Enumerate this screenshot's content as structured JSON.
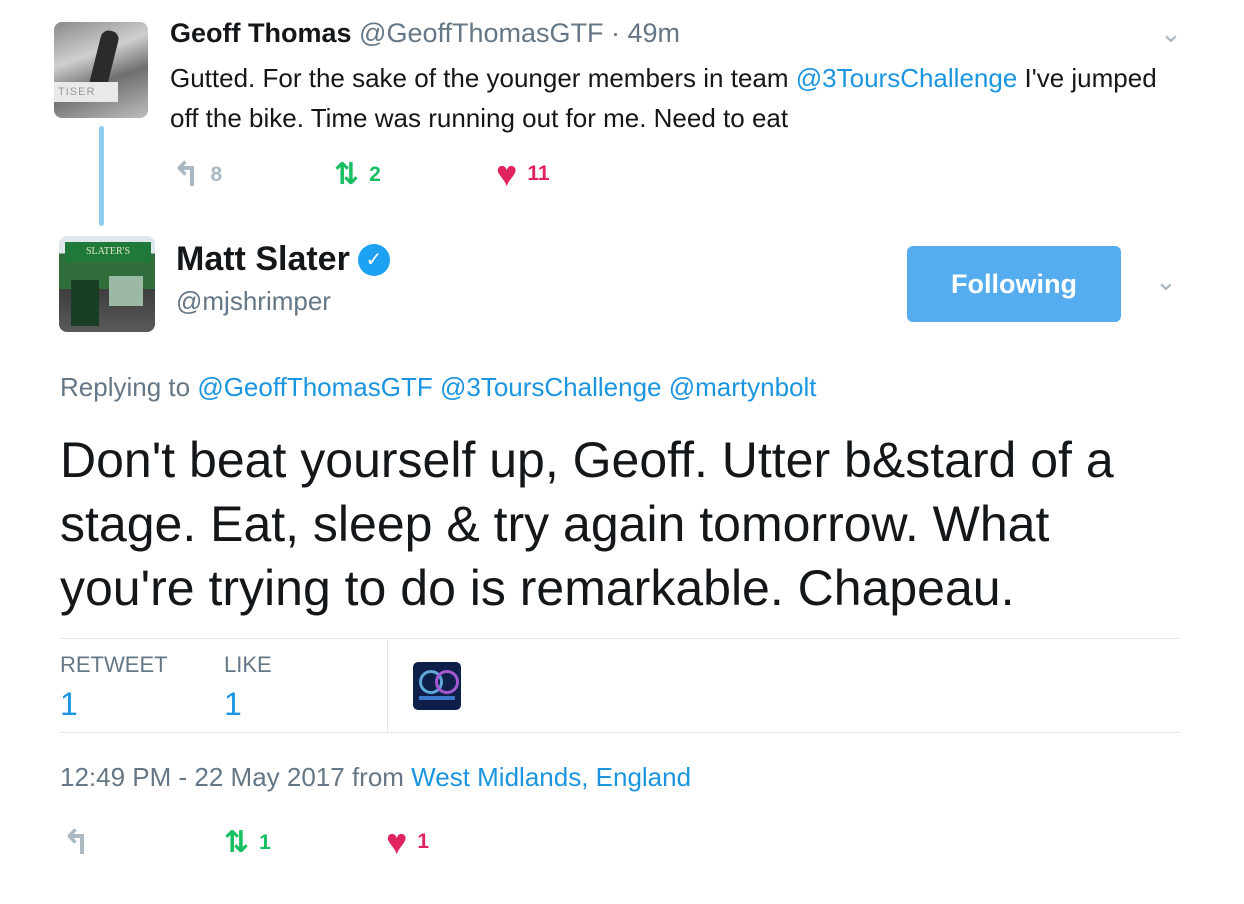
{
  "parent": {
    "name": "Geoff Thomas",
    "handle": "@GeoffThomasGTF",
    "dot": " · ",
    "time": "49m",
    "text_before": "Gutted. For the sake of the younger members in team ",
    "mention": "@3ToursChallenge",
    "text_after": " I've jumped off the bike. Time was running out for me. Need to eat",
    "avatar_sign": "TISER",
    "replies": "8",
    "retweets": "2",
    "likes": "11"
  },
  "tweet": {
    "name": "Matt Slater",
    "verified_glyph": "✓",
    "handle": "@mjshrimper",
    "avatar_sign": "SLATER'S",
    "follow_label": "Following",
    "replying_prefix": "Replying to ",
    "replying_to": [
      "@GeoffThomasGTF",
      "@3ToursChallenge",
      "@martynbolt"
    ],
    "text": "Don't beat yourself up, Geoff. Utter b&stard of a stage. Eat, sleep & try again tomorrow. What you're trying to do is remarkable. Chapeau.",
    "stats": {
      "retweet_label": "RETWEET",
      "retweet_count": "1",
      "like_label": "LIKE",
      "like_count": "1"
    },
    "timestamp_text": "12:49 PM - 22 May 2017 from ",
    "location": "West Midlands, England",
    "actions": {
      "retweets": "1",
      "likes": "1"
    }
  },
  "icons": {
    "reply": "reply-icon",
    "retweet": "retweet-icon",
    "like": "heart-icon",
    "caret": "chevron-down-icon",
    "verified": "verified-badge-icon"
  },
  "colors": {
    "link": "#1b95e0",
    "retweet": "#17bf63",
    "like": "#e0245e",
    "follow_button": "#55acee",
    "thread_line": "#8ecdf0"
  }
}
